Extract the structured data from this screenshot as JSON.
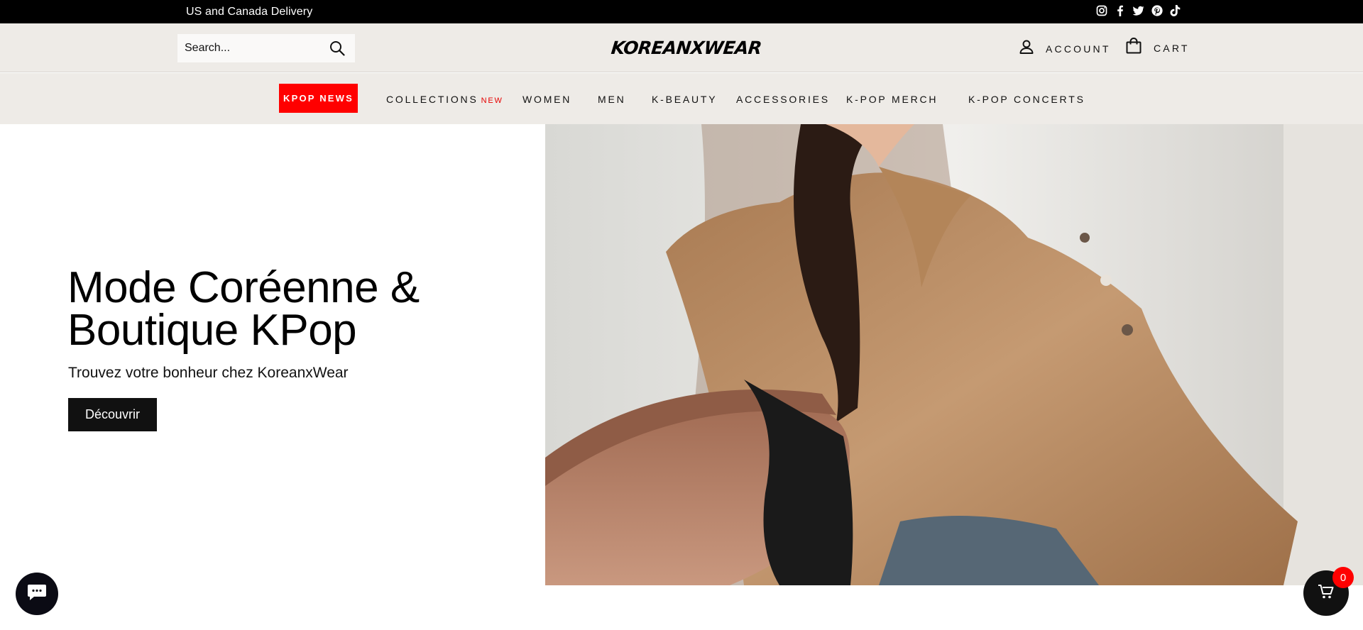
{
  "topbar": {
    "delivery_text": "US and Canada Delivery",
    "socials": [
      "instagram-icon",
      "facebook-icon",
      "twitter-icon",
      "pinterest-icon",
      "tiktok-icon"
    ]
  },
  "header": {
    "search_placeholder": "Search...",
    "logo_text": "KOREANXWEAR",
    "account_label": "ACCOUNT",
    "cart_label": "CART"
  },
  "nav": {
    "kpop_news": "KPOP NEWS",
    "collections": "COLLECTIONS",
    "collections_badge": "NEW",
    "women": "WOMEN",
    "men": "MEN",
    "kbeauty": "K-BEAUTY",
    "accessories": "ACCESSORIES",
    "kpop_merch": "K-POP MERCH",
    "kpop_concerts": "K-POP CONCERTS"
  },
  "hero": {
    "title_line1": "Mode Coréenne &",
    "title_line2": "Boutique KPop",
    "subtitle": "Trouvez votre bonheur chez KoreanxWear",
    "button_label": "Découvrir"
  },
  "floating": {
    "cart_count": "0"
  },
  "colors": {
    "topbar_bg": "#000000",
    "header_bg": "#eeebe7",
    "accent_red": "#ff0000",
    "button_dark": "#111111"
  }
}
